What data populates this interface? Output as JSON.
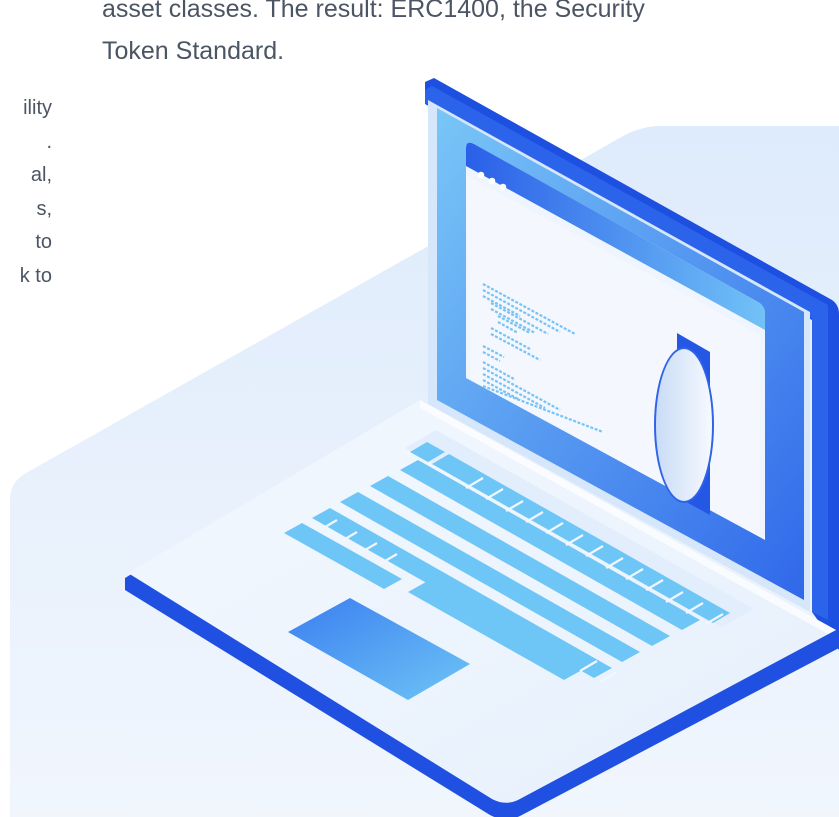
{
  "article": {
    "intro_paragraph": "asset classes. The result: ERC1400, the Security\nToken Standard.",
    "side_paragraph_fragments": "ility\n.\nal,\ns,\nto\nk to"
  },
  "illustration": {
    "subject": "laptop-with-code-editor",
    "icons": [
      "window-dots-icon",
      "code-lines-icon",
      "oval-lens-icon",
      "keyboard-icon",
      "trackpad-icon"
    ],
    "colors": {
      "background_panel": "#e7f1fd",
      "laptop_base_edge": "#2456e6",
      "screen_blue": "#3a78ee",
      "screen_light": "#6cc0f6",
      "keys": "#6cc4f5",
      "trackpad": "#4e93f0",
      "text_gray": "#4b5563"
    }
  }
}
